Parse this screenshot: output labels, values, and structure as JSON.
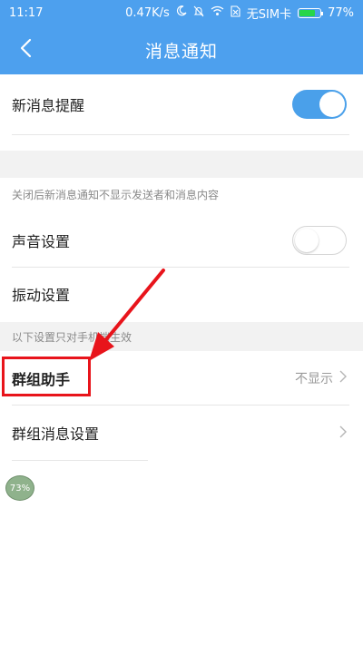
{
  "status_bar": {
    "time": "11:17",
    "network_speed": "0.47K/s",
    "carrier": "无SIM卡",
    "battery_percent": "77%",
    "battery_level": 0.77,
    "icons": [
      "moon-icon",
      "bell-off-icon",
      "wifi-icon",
      "no-sim-icon"
    ]
  },
  "header": {
    "title": "消息通知",
    "back_icon": "chevron-left-icon"
  },
  "settings": {
    "new_message_alert": {
      "label": "新消息提醒",
      "toggle_on": true
    },
    "hint_1": "关闭后新消息通知不显示发送者和消息内容",
    "sound": {
      "label": "声音设置",
      "toggle_on": false
    },
    "vibration": {
      "label": "振动设置"
    },
    "hint_2": "以下设置只对手机端生效",
    "group_assistant": {
      "label": "群组助手",
      "value": "不显示"
    },
    "group_message_settings": {
      "label": "群组消息设置"
    }
  },
  "float_badge": {
    "text": "73%"
  },
  "colors": {
    "accent": "#4da0ee",
    "toggle_on": "#4aa0ea",
    "annotation_red": "#e8141b"
  }
}
